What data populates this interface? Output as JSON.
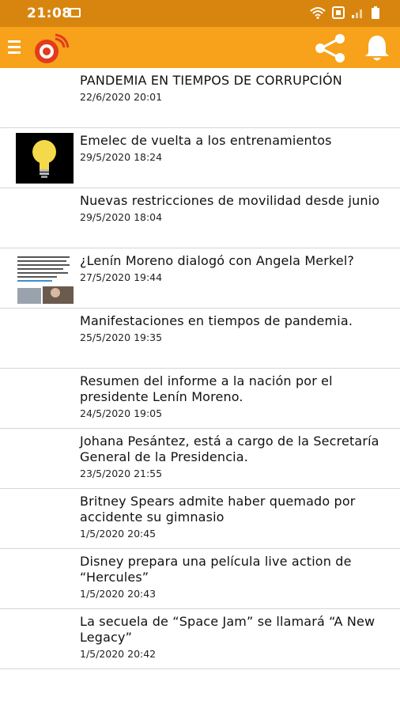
{
  "status_bar": {
    "time": "21:08",
    "icons": [
      "image-icon",
      "wifi-icon",
      "volte-icon",
      "signal-icon",
      "battery-icon"
    ]
  },
  "app_bar": {
    "background": "#f7a21a",
    "icons": [
      "menu-icon",
      "radio-logo-icon",
      "share-icon",
      "bell-icon"
    ]
  },
  "news": [
    {
      "title": "PANDEMIA EN TIEMPOS DE CORRUPCIÓN",
      "date": "22/6/2020 20:01"
    },
    {
      "title": "Emelec de vuelta a los entrenamientos",
      "date": "29/5/2020 18:24",
      "thumbnail": "lightbulb"
    },
    {
      "title": "Nuevas restricciones de movilidad desde junio",
      "date": "29/5/2020 18:04"
    },
    {
      "title": "¿Lenín Moreno dialogó con Angela Merkel?",
      "date": "27/5/2020 19:44",
      "thumbnail": "tweet"
    },
    {
      "title": "Manifestaciones en tiempos de pandemia.",
      "date": "25/5/2020 19:35"
    },
    {
      "title": "Resumen del informe a la nación por el presidente Lenín Moreno.",
      "date": "24/5/2020 19:05"
    },
    {
      "title": "Johana Pesántez, está a cargo de la Secretaría General de la Presidencia.",
      "date": "23/5/2020 21:55"
    },
    {
      "title": "Britney Spears admite haber quemado por accidente su gimnasio",
      "date": "1/5/2020 20:45"
    },
    {
      "title": "Disney prepara una película live action de “Hercules”",
      "date": "1/5/2020 20:43"
    },
    {
      "title": "La secuela de “Space Jam” se llamará “A New Legacy”",
      "date": "1/5/2020 20:42"
    }
  ]
}
